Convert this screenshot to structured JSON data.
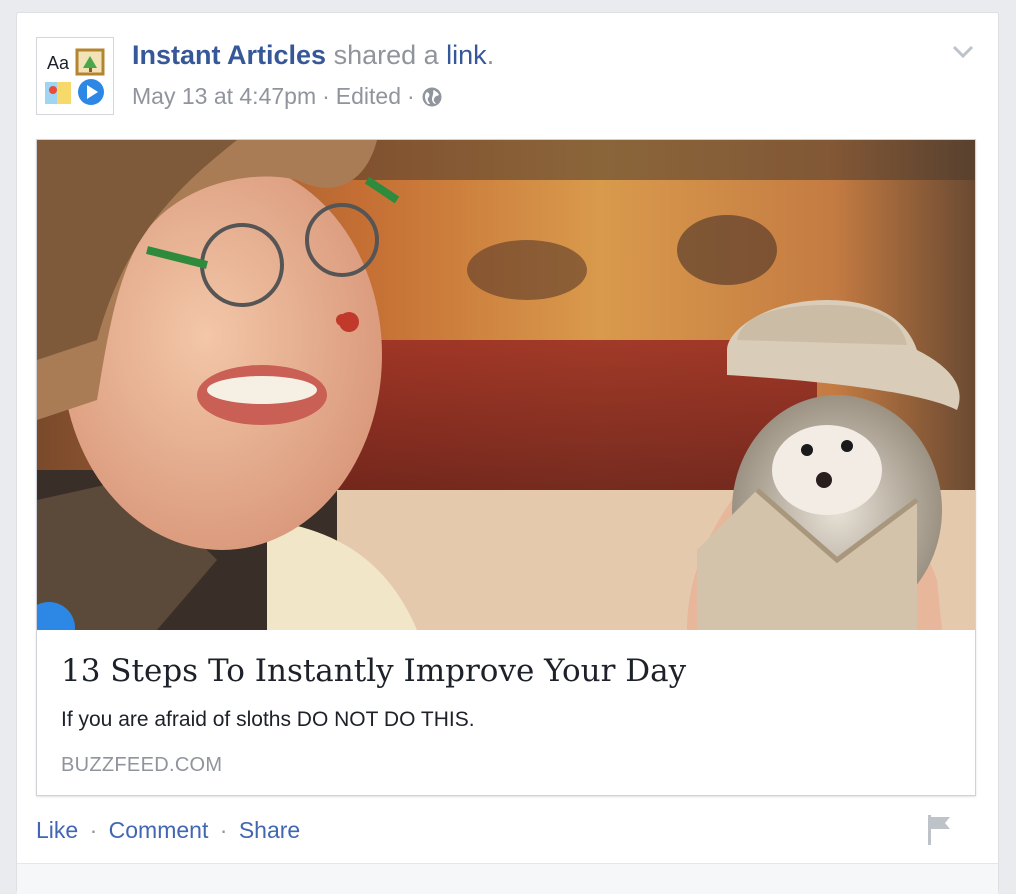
{
  "post": {
    "author": "Instant Articles",
    "verb": "shared a",
    "object_link": "link",
    "period": ".",
    "timestamp": "May 13 at 4:47pm",
    "sep1": "·",
    "edited": "Edited",
    "sep2": "·",
    "privacy_icon": "globe-icon",
    "menu_icon": "chevron-down-icon",
    "avatar_icon": "instant-articles-logo",
    "avatar_text": "Aa"
  },
  "attachment": {
    "image_desc": "hero-image",
    "title": "13 Steps To Instantly Improve Your Day",
    "description": "If you are afraid of sloths DO NOT DO THIS.",
    "domain": "BUZZFEED.COM"
  },
  "actions": {
    "like": "Like",
    "sep1": "·",
    "comment": "Comment",
    "sep2": "·",
    "share": "Share",
    "report_icon": "flag-icon"
  },
  "colors": {
    "link": "#365899",
    "action": "#4267b2",
    "meta": "#90949c",
    "text": "#1d2129"
  }
}
